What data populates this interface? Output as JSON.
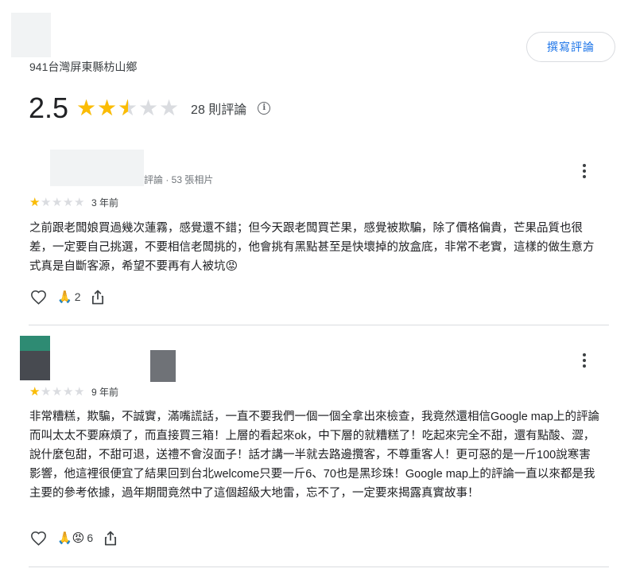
{
  "place": {
    "address": "941台灣屏東縣枋山鄉",
    "write_review_label": "撰寫評論",
    "rating": "2.5",
    "rating_value": 2.5,
    "review_count": "28 則評論",
    "info_icon": "i"
  },
  "reviews": [
    {
      "meta": "評論 · 53 張相片",
      "stars": 1,
      "time": "3 年前",
      "text": "之前跟老闆娘買過幾次蓮霧，感覺還不錯；但今天跟老闆買芒果，感覺被欺騙，除了價格偏貴，芒果品質也很差，一定要自己挑選，不要相信老闆挑的，他會挑有黑點甚至是快壞掉的放盒底，非常不老實，這樣的做生意方式真是自斷客源，希望不要再有人被坑",
      "text_emoji": "😡",
      "reaction_emoji": "🙏",
      "reaction_count": "2"
    },
    {
      "stars": 1,
      "time": "9 年前",
      "text": "非常糟糕，欺騙，不誠實，滿嘴謊話，一直不要我們一個一個全拿出來檢查，我竟然還相信Google map上的評論而叫太太不要麻煩了，而直接買三箱！上層的看起來ok，中下層的就糟糕了！吃起來完全不甜，還有點酸、澀，說什麼包甜，不甜可退，送禮不會沒面子！話才講一半就去路邊攬客，不尊重客人！更可惡的是一斤100說寒害影響，他這裡很便宜了結果回到台北welcome只要一斤6、70也是黑珍珠！Google map上的評論一直以來都是我主要的參考依據，過年期間竟然中了這個超級大地雷，忘不了，一定要來揭露真實故事！",
      "reaction_emoji": "🙏😡",
      "reaction_count": "6"
    }
  ],
  "icons": {
    "star": "★",
    "heart": "heart-icon",
    "share": "share-icon",
    "more": "more-vert-icon",
    "info": "info-icon"
  },
  "colors": {
    "star_filled": "#fbbc04",
    "star_empty": "#dadce0",
    "accent": "#1a73e8",
    "avatar_teal": "#2e8b73",
    "avatar_dark": "#474a50",
    "thumb_gray": "#6f7277"
  }
}
